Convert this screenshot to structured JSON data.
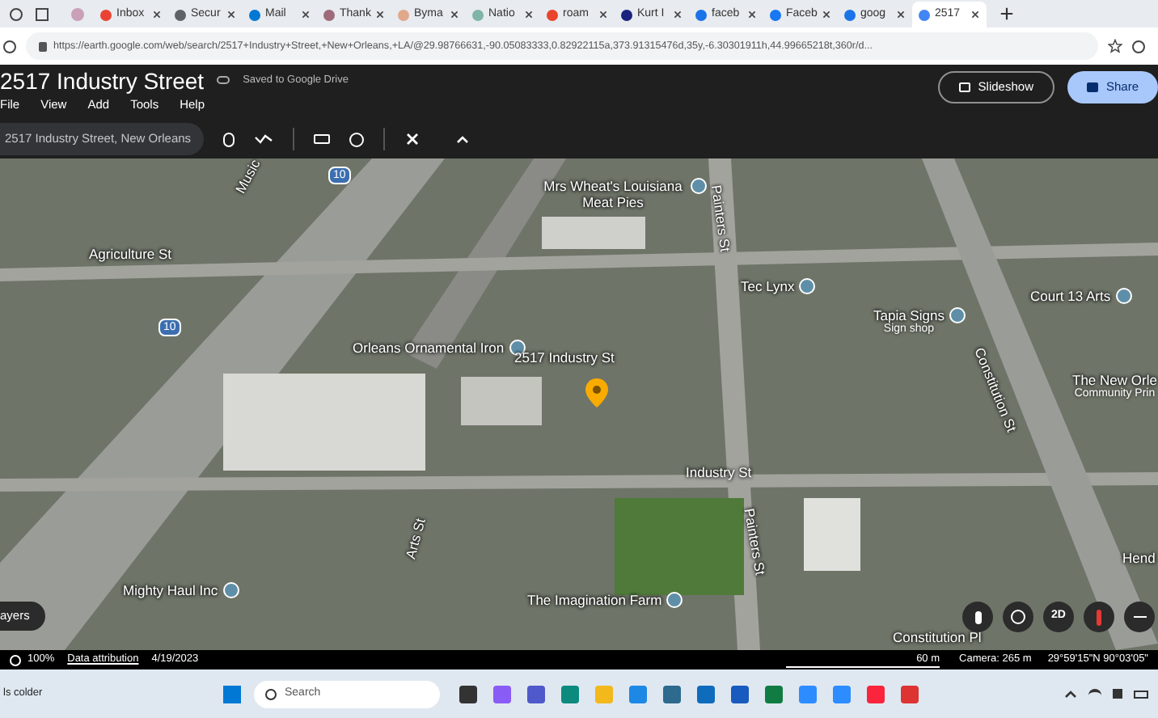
{
  "browser": {
    "tabs": [
      {
        "label": "Inbox",
        "selected": false,
        "color": "#ea4335"
      },
      {
        "label": "Secur",
        "selected": false,
        "color": "#5f6368"
      },
      {
        "label": "Mail",
        "selected": false,
        "color": "#0078d4"
      },
      {
        "label": "Thank",
        "selected": false,
        "color": "#9e6b7a"
      },
      {
        "label": "Byma",
        "selected": false,
        "color": "#e0a98a"
      },
      {
        "label": "Natio",
        "selected": false,
        "color": "#7fb5a8"
      },
      {
        "label": "roam",
        "selected": false,
        "color": "#e8452c"
      },
      {
        "label": "Kurt I",
        "selected": false,
        "color": "#1a237e"
      },
      {
        "label": "faceb",
        "selected": false,
        "color": "#1a73e8"
      },
      {
        "label": "Faceb",
        "selected": false,
        "color": "#1877f2"
      },
      {
        "label": "goog",
        "selected": false,
        "color": "#1a73e8"
      },
      {
        "label": "2517",
        "selected": true,
        "color": "#4285f4"
      }
    ],
    "url": "https://earth.google.com/web/search/2517+Industry+Street,+New+Orleans,+LA/@29.98766631,-90.05083333,0.82922115a,373.91315476d,35y,-6.30301911h,44.99665218t,360r/d..."
  },
  "app": {
    "title": "2517 Industry Street",
    "save_status": "Saved to Google Drive",
    "menu": [
      "File",
      "View",
      "Add",
      "Tools",
      "Help"
    ],
    "buttons": [
      {
        "label": "Slideshow",
        "kind": "outline"
      },
      {
        "label": "Share",
        "kind": "filled"
      }
    ],
    "search": {
      "value": "2517 Industry Street, New Orleans"
    }
  },
  "map": {
    "labels": [
      {
        "text": "Music",
        "kind": "street"
      },
      {
        "text": "Agriculture St",
        "kind": "street"
      },
      {
        "text": "10",
        "kind": "highway"
      },
      {
        "text": "10",
        "kind": "highway"
      },
      {
        "text": "Mrs Wheat's Louisiana Meat Pies",
        "kind": "place"
      },
      {
        "text": "Painters St",
        "kind": "street"
      },
      {
        "text": "Tec Lynx",
        "kind": "place"
      },
      {
        "text": "Tapia Signs",
        "kind": "place",
        "subtitle": "Sign shop"
      },
      {
        "text": "Court 13 Arts",
        "kind": "place"
      },
      {
        "text": "The New Orle",
        "kind": "place",
        "subtitle": "Community Prin"
      },
      {
        "text": "Orleans Ornamental Iron",
        "kind": "place"
      },
      {
        "text": "2517 Industry St",
        "kind": "target"
      },
      {
        "text": "Industry St",
        "kind": "street"
      },
      {
        "text": "Arts St",
        "kind": "street"
      },
      {
        "text": "Painters St",
        "kind": "street"
      },
      {
        "text": "Mighty Haul Inc",
        "kind": "place"
      },
      {
        "text": "The Imagination Farm",
        "kind": "place"
      },
      {
        "text": "Constitution Pl",
        "kind": "street"
      },
      {
        "text": "Constitution St",
        "kind": "street"
      },
      {
        "text": "Hend",
        "kind": "place"
      }
    ],
    "layers_button": "ayers",
    "view_mode": "2D"
  },
  "status_bar": {
    "zoom": "100%",
    "attribution": "Data attribution",
    "date": "4/19/2023",
    "scale": "60 m",
    "camera": "Camera: 265 m",
    "coordinates": "29°59'15\"N 90°03'05\""
  },
  "taskbar": {
    "weather": "ls colder",
    "search_placeholder": "Search"
  }
}
